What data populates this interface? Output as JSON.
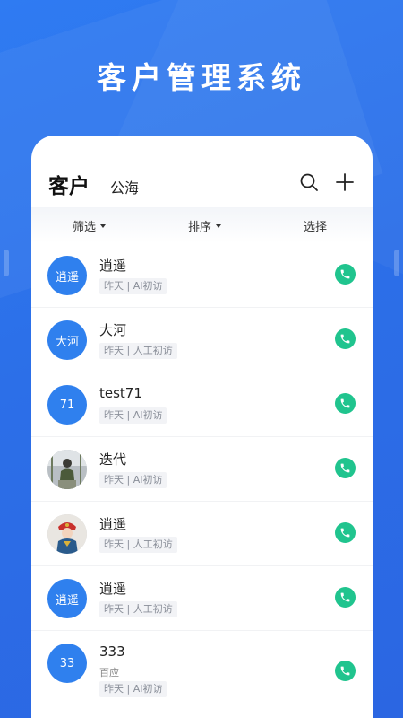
{
  "banner_title": "客户管理系统",
  "header": {
    "active_tab": "客户",
    "secondary_tab": "公海",
    "search_icon": "search-icon",
    "add_icon": "plus-icon"
  },
  "filters": {
    "filter_label": "筛选",
    "sort_label": "排序",
    "select_label": "选择"
  },
  "colors": {
    "background": "#2c6fe8",
    "avatar": "#2f80ee",
    "call_button": "#20c48e"
  },
  "customers": [
    {
      "avatar_text": "逍遥",
      "name": "逍遥",
      "tag": "昨天 | AI初访"
    },
    {
      "avatar_text": "大河",
      "name": "大河",
      "tag": "昨天 | 人工初访"
    },
    {
      "avatar_text": "71",
      "name": "test71",
      "tag": "昨天 | AI初访"
    },
    {
      "avatar_text": "",
      "name": "迭代",
      "tag": "昨天 | AI初访",
      "avatar_type": "photo"
    },
    {
      "avatar_text": "",
      "name": "逍遥",
      "tag": "昨天 | 人工初访",
      "avatar_type": "photo"
    },
    {
      "avatar_text": "逍遥",
      "name": "逍遥",
      "tag": "昨天 | 人工初访"
    },
    {
      "avatar_text": "33",
      "name": "333",
      "source": "百应",
      "tag": "昨天 | AI初访"
    }
  ]
}
